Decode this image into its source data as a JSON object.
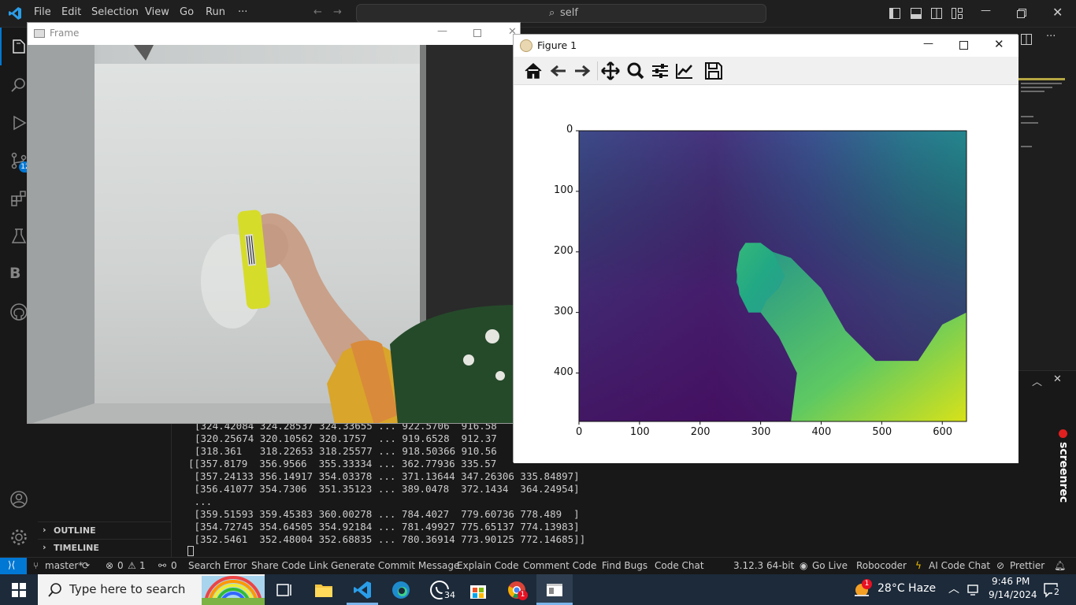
{
  "vscode": {
    "menu": [
      "File",
      "Edit",
      "Selection",
      "View",
      "Go",
      "Run",
      "···"
    ],
    "search_placeholder": "self",
    "sidebar_sections": {
      "outline": "OUTLINE",
      "timeline": "TIMELINE"
    },
    "scm_badge": "12",
    "terminal_lines": [
      "[324.42084 324.28537 324.33655 ... 922.5706  916.58",
      "[320.25674 320.10562 320.1757  ... 919.6528  912.37",
      "[318.361   318.22653 318.25577 ... 918.50366 910.56",
      "[[357.8179  356.9566  355.33334 ... 362.77936 335.57",
      " [357.24133 356.14917 354.03378 ... 371.13644 347.26306 335.84897]",
      " [356.41077 354.7306  351.35123 ... 389.0478  372.1434  364.24954]",
      " ...",
      " [359.51593 359.45383 360.00278 ... 784.4027  779.60736 778.489  ]",
      " [354.72745 354.64505 354.92184 ... 781.49927 775.65137 774.13983]",
      " [352.5461  352.48004 352.68835 ... 780.36914 773.90125 772.14685]]"
    ],
    "status": {
      "branch": "master*",
      "errors": "0",
      "warnings": "1",
      "ports": "0",
      "items": [
        "Search Error",
        "Share Code Link",
        "Generate Commit Message",
        "Explain Code",
        "Comment Code",
        "Find Bugs",
        "Code Chat"
      ],
      "python": "3.12.3 64-bit",
      "go_live": "Go Live",
      "robocoder": "Robocoder",
      "ai_chat": "AI Code Chat",
      "prettier": "Prettier"
    },
    "screenrec": "screenrec"
  },
  "frame_window": {
    "title": "Frame"
  },
  "figure_window": {
    "title": "Figure 1",
    "tools": [
      "home-icon",
      "back-icon",
      "forward-icon",
      "pan-icon",
      "zoom-icon",
      "configure-subplots-icon",
      "edit-axis-icon",
      "save-icon"
    ]
  },
  "chart_data": {
    "type": "heatmap",
    "colormap": "viridis",
    "xlim": [
      0,
      640
    ],
    "ylim": [
      480,
      0
    ],
    "x_ticks": [
      "0",
      "100",
      "200",
      "300",
      "400",
      "500",
      "600"
    ],
    "y_ticks": [
      "0",
      "100",
      "200",
      "300",
      "400"
    ]
  },
  "taskbar": {
    "search_placeholder": "Type here to search",
    "whatsapp_badge": "34",
    "chrome_badge": "1",
    "weather_badge": "1",
    "weather": "28°C  Haze",
    "time": "9:46 PM",
    "date": "9/14/2024",
    "notifications": "2"
  }
}
